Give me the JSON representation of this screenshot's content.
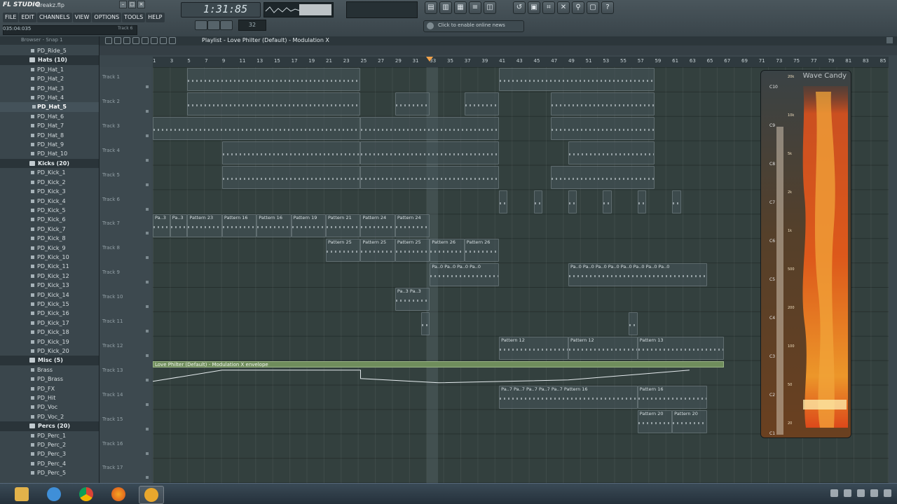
{
  "app": {
    "logo": "FL STUDIO",
    "project_name": "Breakz.flp",
    "menu": [
      "FILE",
      "EDIT",
      "CHANNELS",
      "VIEW",
      "OPTIONS",
      "TOOLS",
      "HELP"
    ],
    "hint_time": "035:04:035",
    "hint_right": "Track 6",
    "song_time": "1:31:85",
    "pattern_number": "32",
    "news_text": "Click to enable online news"
  },
  "browser": {
    "header": "Browser - Snap 1",
    "items": [
      {
        "label": "PD_Ride_5",
        "type": "file"
      },
      {
        "label": "Hats (10)",
        "type": "folder"
      },
      {
        "label": "PD_Hat_1",
        "type": "file"
      },
      {
        "label": "PD_Hat_2",
        "type": "file"
      },
      {
        "label": "PD_Hat_3",
        "type": "file"
      },
      {
        "label": "PD_Hat_4",
        "type": "file"
      },
      {
        "label": "PD_Hat_5",
        "type": "file",
        "selected": true
      },
      {
        "label": "PD_Hat_6",
        "type": "file"
      },
      {
        "label": "PD_Hat_7",
        "type": "file"
      },
      {
        "label": "PD_Hat_8",
        "type": "file"
      },
      {
        "label": "PD_Hat_9",
        "type": "file"
      },
      {
        "label": "PD_Hat_10",
        "type": "file"
      },
      {
        "label": "Kicks (20)",
        "type": "folder"
      },
      {
        "label": "PD_Kick_1",
        "type": "file"
      },
      {
        "label": "PD_Kick_2",
        "type": "file"
      },
      {
        "label": "PD_Kick_3",
        "type": "file"
      },
      {
        "label": "PD_Kick_4",
        "type": "file"
      },
      {
        "label": "PD_Kick_5",
        "type": "file"
      },
      {
        "label": "PD_Kick_6",
        "type": "file"
      },
      {
        "label": "PD_Kick_7",
        "type": "file"
      },
      {
        "label": "PD_Kick_8",
        "type": "file"
      },
      {
        "label": "PD_Kick_9",
        "type": "file"
      },
      {
        "label": "PD_Kick_10",
        "type": "file"
      },
      {
        "label": "PD_Kick_11",
        "type": "file"
      },
      {
        "label": "PD_Kick_12",
        "type": "file"
      },
      {
        "label": "PD_Kick_13",
        "type": "file"
      },
      {
        "label": "PD_Kick_14",
        "type": "file"
      },
      {
        "label": "PD_Kick_15",
        "type": "file"
      },
      {
        "label": "PD_Kick_16",
        "type": "file"
      },
      {
        "label": "PD_Kick_17",
        "type": "file"
      },
      {
        "label": "PD_Kick_18",
        "type": "file"
      },
      {
        "label": "PD_Kick_19",
        "type": "file"
      },
      {
        "label": "PD_Kick_20",
        "type": "file"
      },
      {
        "label": "Misc (5)",
        "type": "folder"
      },
      {
        "label": "Brass",
        "type": "file"
      },
      {
        "label": "PD_Brass",
        "type": "file"
      },
      {
        "label": "PD_FX",
        "type": "file"
      },
      {
        "label": "PD_Hit",
        "type": "file"
      },
      {
        "label": "PD_Voc",
        "type": "file"
      },
      {
        "label": "PD_Voc_2",
        "type": "file"
      },
      {
        "label": "Percs (20)",
        "type": "folder"
      },
      {
        "label": "PD_Perc_1",
        "type": "file"
      },
      {
        "label": "PD_Perc_2",
        "type": "file"
      },
      {
        "label": "PD_Perc_3",
        "type": "file"
      },
      {
        "label": "PD_Perc_4",
        "type": "file"
      },
      {
        "label": "PD_Perc_5",
        "type": "file"
      }
    ]
  },
  "playlist": {
    "title": "Playlist - Love Philter (Default) - Modulation X",
    "bars": [
      "1",
      "3",
      "5",
      "7",
      "9",
      "11",
      "13",
      "15",
      "17",
      "19",
      "21",
      "23",
      "25",
      "27",
      "29",
      "31",
      "33",
      "35",
      "37",
      "39",
      "41",
      "43",
      "45",
      "47",
      "49",
      "51",
      "53",
      "55",
      "57",
      "59",
      "61",
      "63",
      "65",
      "67",
      "69",
      "71",
      "73",
      "75",
      "77",
      "79",
      "81",
      "83",
      "85"
    ],
    "tracks": [
      "Track 1",
      "Track 2",
      "Track 3",
      "Track 4",
      "Track 5",
      "Track 6",
      "Track 7",
      "Track 8",
      "Track 9",
      "Track 10",
      "Track 11",
      "Track 12",
      "Track 13",
      "Track 14",
      "Track 15",
      "Track 16",
      "Track 17"
    ],
    "clips": [
      {
        "track": 0,
        "start": 5,
        "end": 25,
        "label": ""
      },
      {
        "track": 0,
        "start": 41,
        "end": 59,
        "label": ""
      },
      {
        "track": 1,
        "start": 5,
        "end": 25,
        "label": ""
      },
      {
        "track": 1,
        "start": 29,
        "end": 33,
        "label": ""
      },
      {
        "track": 1,
        "start": 37,
        "end": 41,
        "label": ""
      },
      {
        "track": 1,
        "start": 47,
        "end": 59,
        "label": ""
      },
      {
        "track": 2,
        "start": 1,
        "end": 25,
        "label": ""
      },
      {
        "track": 2,
        "start": 25,
        "end": 41,
        "label": ""
      },
      {
        "track": 2,
        "start": 47,
        "end": 59,
        "label": ""
      },
      {
        "track": 3,
        "start": 9,
        "end": 25,
        "label": ""
      },
      {
        "track": 3,
        "start": 25,
        "end": 41,
        "label": ""
      },
      {
        "track": 3,
        "start": 49,
        "end": 59,
        "label": ""
      },
      {
        "track": 4,
        "start": 9,
        "end": 25,
        "label": ""
      },
      {
        "track": 4,
        "start": 25,
        "end": 41,
        "label": ""
      },
      {
        "track": 4,
        "start": 47,
        "end": 59,
        "label": ""
      },
      {
        "track": 5,
        "start": 41,
        "end": 42,
        "label": ""
      },
      {
        "track": 5,
        "start": 45,
        "end": 46,
        "label": ""
      },
      {
        "track": 5,
        "start": 49,
        "end": 50,
        "label": ""
      },
      {
        "track": 5,
        "start": 53,
        "end": 54,
        "label": ""
      },
      {
        "track": 5,
        "start": 57,
        "end": 58,
        "label": ""
      },
      {
        "track": 5,
        "start": 61,
        "end": 62,
        "label": ""
      },
      {
        "track": 6,
        "start": 1,
        "end": 3,
        "label": "Pa..3"
      },
      {
        "track": 6,
        "start": 3,
        "end": 5,
        "label": "Pa..3"
      },
      {
        "track": 6,
        "start": 5,
        "end": 9,
        "label": "Pattern 23"
      },
      {
        "track": 6,
        "start": 9,
        "end": 13,
        "label": "Pattern 16"
      },
      {
        "track": 6,
        "start": 13,
        "end": 17,
        "label": "Pattern 16"
      },
      {
        "track": 6,
        "start": 17,
        "end": 21,
        "label": "Pattern 19"
      },
      {
        "track": 6,
        "start": 21,
        "end": 25,
        "label": "Pattern 21"
      },
      {
        "track": 6,
        "start": 25,
        "end": 29,
        "label": "Pattern 24"
      },
      {
        "track": 6,
        "start": 29,
        "end": 33,
        "label": "Pattern 24"
      },
      {
        "track": 7,
        "start": 21,
        "end": 25,
        "label": "Pattern 25"
      },
      {
        "track": 7,
        "start": 25,
        "end": 29,
        "label": "Pattern 25"
      },
      {
        "track": 7,
        "start": 29,
        "end": 33,
        "label": "Pattern 25"
      },
      {
        "track": 7,
        "start": 33,
        "end": 37,
        "label": "Pattern 26"
      },
      {
        "track": 7,
        "start": 37,
        "end": 41,
        "label": "Pattern 26"
      },
      {
        "track": 8,
        "start": 33,
        "end": 41,
        "label": "Pa..0 Pa..0 Pa..0 Pa..0"
      },
      {
        "track": 8,
        "start": 49,
        "end": 65,
        "label": "Pa..0 Pa..0 Pa..0 Pa..0 Pa..0 Pa..0 Pa..0 Pa..0"
      },
      {
        "track": 9,
        "start": 29,
        "end": 33,
        "label": "Pa..3 Pa..3"
      },
      {
        "track": 10,
        "start": 32,
        "end": 33,
        "label": ""
      },
      {
        "track": 10,
        "start": 56,
        "end": 57,
        "label": ""
      },
      {
        "track": 11,
        "start": 41,
        "end": 49,
        "label": "Pattern 12"
      },
      {
        "track": 11,
        "start": 49,
        "end": 57,
        "label": "Pattern 12"
      },
      {
        "track": 11,
        "start": 57,
        "end": 67,
        "label": "Pattern 13"
      },
      {
        "track": 13,
        "start": 41,
        "end": 57,
        "label": "Pa..7 Pa..7 Pa..7 Pa..7 Pa..7 Pattern 16"
      },
      {
        "track": 13,
        "start": 57,
        "end": 65,
        "label": "Pattern 16"
      },
      {
        "track": 14,
        "start": 57,
        "end": 61,
        "label": "Pattern 20"
      },
      {
        "track": 14,
        "start": 61,
        "end": 65,
        "label": "Pattern 20"
      }
    ],
    "automation": {
      "track": 12,
      "start": 1,
      "end": 67,
      "label": "Love Philter (Default) - Modulation X envelope"
    },
    "playhead_bar": 33
  },
  "wave_candy": {
    "title": "Wave Candy",
    "notes": [
      "C10",
      "C9",
      "C8",
      "C7",
      "C6",
      "C5",
      "C4",
      "C3",
      "C2",
      "C1"
    ],
    "hz_labels": [
      "20k",
      "10k",
      "5k",
      "2k",
      "1k",
      "500",
      "200",
      "100",
      "50",
      "20"
    ]
  },
  "taskbar": {
    "apps": [
      "file-explorer",
      "internet-explorer",
      "chrome",
      "firefox",
      "fl-studio"
    ]
  },
  "colors": {
    "accent": "#f2a24a",
    "automation": "#6f8d5c"
  }
}
